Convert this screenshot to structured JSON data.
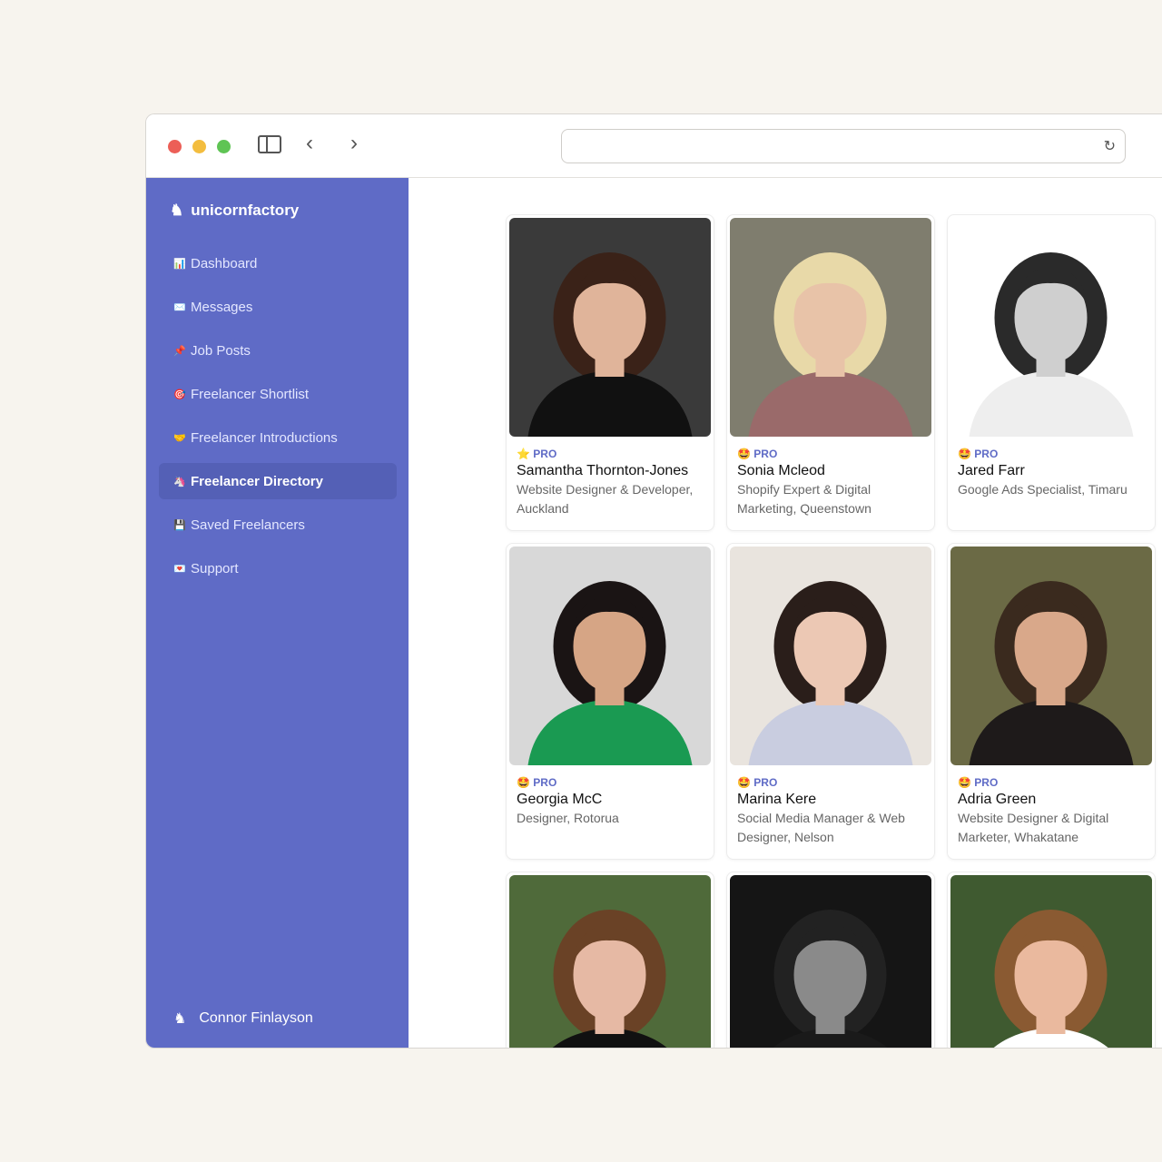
{
  "browser": {
    "back_icon": "chevron-left",
    "forward_icon": "chevron-right",
    "sidebar_icon": "sidebar-toggle",
    "reload_icon": "reload",
    "url": ""
  },
  "brand": {
    "name": "unicornfactory"
  },
  "sidebar": {
    "items": [
      {
        "label": "Dashboard",
        "icon": "📊",
        "active": false
      },
      {
        "label": "Messages",
        "icon": "✉️",
        "active": false
      },
      {
        "label": "Job Posts",
        "icon": "📌",
        "active": false
      },
      {
        "label": "Freelancer Shortlist",
        "icon": "🎯",
        "active": false
      },
      {
        "label": "Freelancer Introductions",
        "icon": "🤝",
        "active": false
      },
      {
        "label": "Freelancer Directory",
        "icon": "🦄",
        "active": true
      },
      {
        "label": "Saved Freelancers",
        "icon": "💾",
        "active": false
      },
      {
        "label": "Support",
        "icon": "💌",
        "active": false
      }
    ]
  },
  "user": {
    "name": "Connor Finlayson"
  },
  "colors": {
    "accent": "#5f6bc6",
    "active_item": "#5460b6"
  },
  "freelancers": [
    {
      "badge": "PRO",
      "badge_icon": "⭐",
      "name": "Samantha Thornton-Jones",
      "desc": "Website Designer & Developer, Auckland",
      "bg": "#3a3a3a",
      "skin": "#e0b49a",
      "hair": "#3a2218",
      "shirt": "#111"
    },
    {
      "badge": "PRO",
      "badge_icon": "🤩",
      "name": "Sonia Mcleod",
      "desc": "Shopify Expert & Digital Marketing, Queenstown",
      "bg": "#7f7d6e",
      "skin": "#e8c3a8",
      "hair": "#e8d9a8",
      "shirt": "#9a6a6a"
    },
    {
      "badge": "PRO",
      "badge_icon": "🤩",
      "name": "Jared Farr",
      "desc": "Google Ads Specialist, Timaru",
      "bg": "#ffffff",
      "skin": "#cfcfcf",
      "hair": "#2a2a2a",
      "shirt": "#eeeeee"
    },
    {
      "badge": "PRO",
      "badge_icon": "🤩",
      "name": "Georgia McC",
      "desc": "Designer, Rotorua",
      "bg": "#d8d8d8",
      "skin": "#d6a585",
      "hair": "#1a1414",
      "shirt": "#1a9a52"
    },
    {
      "badge": "PRO",
      "badge_icon": "🤩",
      "name": "Marina Kere",
      "desc": "Social Media Manager & Web Designer, Nelson",
      "bg": "#e9e4de",
      "skin": "#ecc8b4",
      "hair": "#2a1e1a",
      "shirt": "#c9cde0"
    },
    {
      "badge": "PRO",
      "badge_icon": "🤩",
      "name": "Adria Green",
      "desc": "Website Designer & Digital Marketer, Whakatane",
      "bg": "#6b6a45",
      "skin": "#d9a88a",
      "hair": "#3a2a1e",
      "shirt": "#1e1a1a"
    },
    {
      "badge": "",
      "badge_icon": "",
      "name": "",
      "desc": "",
      "bg": "#4f6a3a",
      "skin": "#e6b9a4",
      "hair": "#6a4226",
      "shirt": "#111"
    },
    {
      "badge": "",
      "badge_icon": "",
      "name": "",
      "desc": "",
      "bg": "#151515",
      "skin": "#8a8a8a",
      "hair": "#222",
      "shirt": "#1a1a1a"
    },
    {
      "badge": "",
      "badge_icon": "",
      "name": "",
      "desc": "",
      "bg": "#3f5a30",
      "skin": "#eab99e",
      "hair": "#8a5a32",
      "shirt": "#fff"
    }
  ]
}
